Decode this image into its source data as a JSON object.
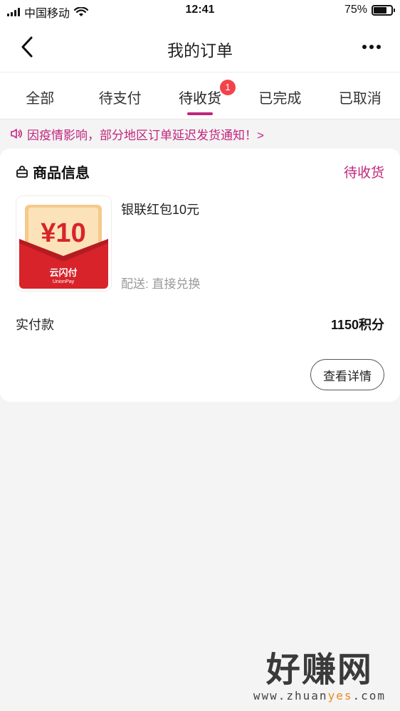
{
  "status_bar": {
    "carrier": "中国移动",
    "time": "12:41",
    "battery_percent": "75%",
    "battery_level": 0.75
  },
  "nav": {
    "title": "我的订单",
    "back_icon": "chevron-left-icon",
    "more_icon": "more-dots-icon"
  },
  "tabs": [
    {
      "label": "全部",
      "active": false
    },
    {
      "label": "待支付",
      "active": false
    },
    {
      "label": "待收货",
      "active": true,
      "badge": "1"
    },
    {
      "label": "已完成",
      "active": false
    },
    {
      "label": "已取消",
      "active": false
    }
  ],
  "notice": {
    "text": "因疫情影响，部分地区订单延迟发货通知！>",
    "icon": "speaker-icon"
  },
  "order": {
    "section_title": "商品信息",
    "status": "待收货",
    "product": {
      "name": "银联红包10元",
      "thumb_amount": "¥10",
      "thumb_brand": "云闪付",
      "thumb_brand_en": "UnionPay"
    },
    "delivery": "配送: 直接兑换",
    "paid_label": "实付款",
    "paid_value": "1150积分",
    "detail_button": "查看详情"
  },
  "watermark": {
    "main": "好赚网",
    "sub_prefix": "www.zhuan",
    "sub_highlight": "yes",
    "sub_suffix": ".com"
  },
  "colors": {
    "accent": "#c2257d",
    "badge": "#f2434b",
    "background": "#f4f4f4"
  }
}
